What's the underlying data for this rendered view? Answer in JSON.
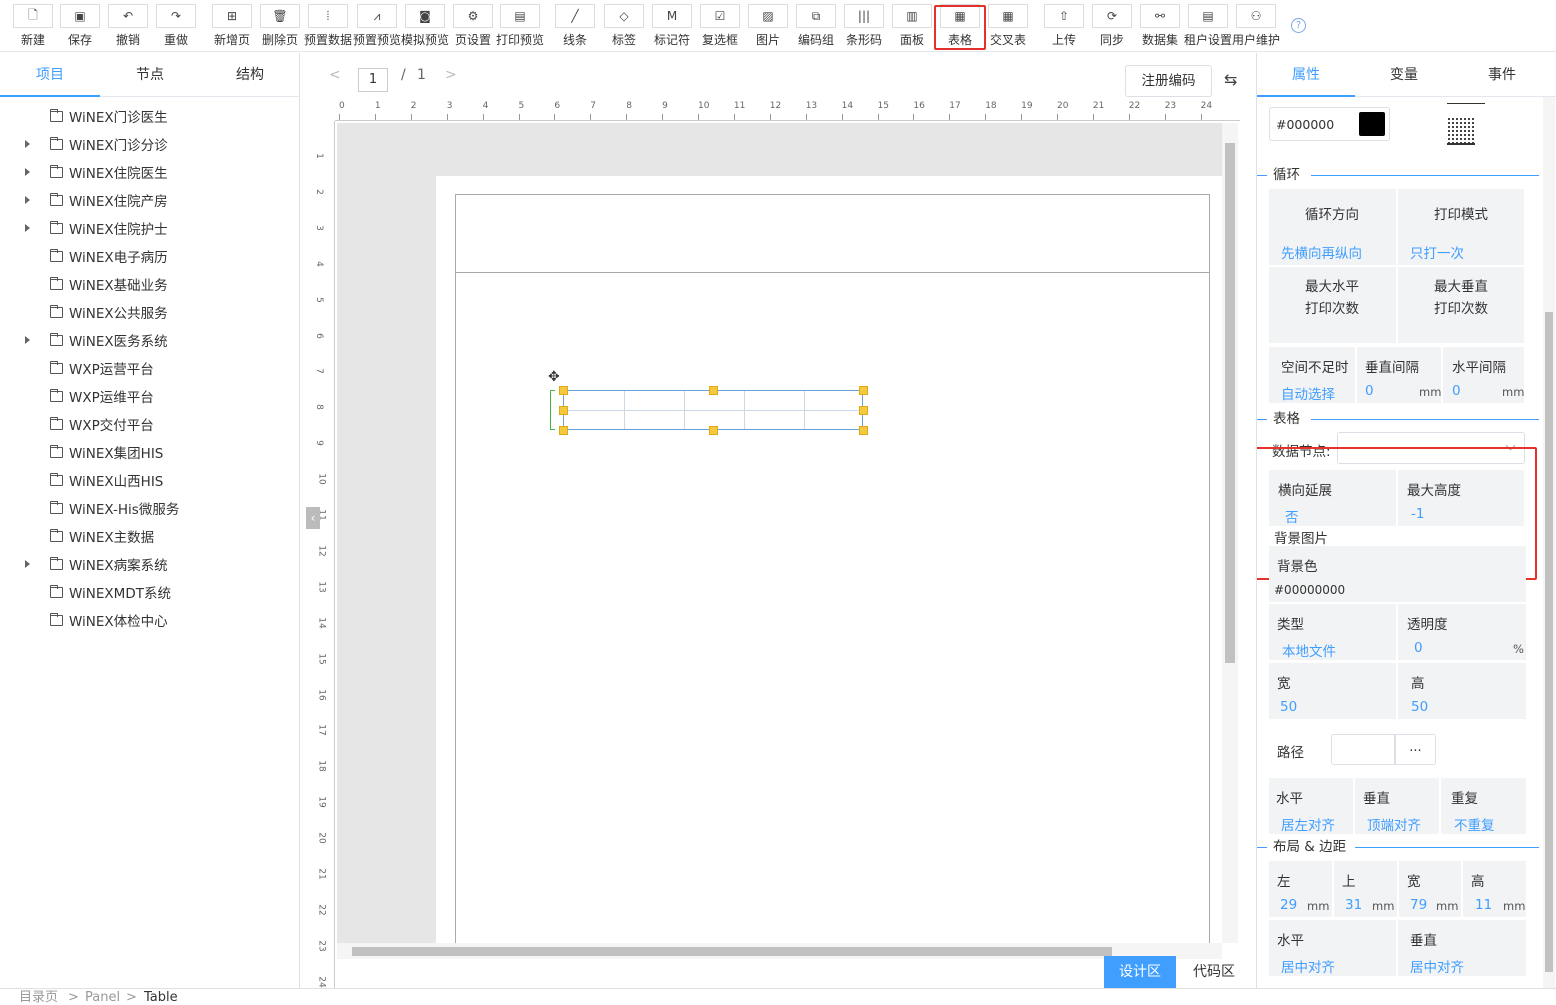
{
  "toolbar": {
    "buttons": [
      {
        "label": "新建",
        "icon": "file-plus-icon"
      },
      {
        "label": "保存",
        "icon": "save-icon"
      },
      {
        "label": "撤销",
        "icon": "undo-icon"
      },
      {
        "label": "重做",
        "icon": "redo-icon"
      },
      {
        "label": "新增页",
        "icon": "add-page-icon"
      },
      {
        "label": "删除页",
        "icon": "trash-icon"
      },
      {
        "label": "预置数据",
        "icon": "preset-data-icon"
      },
      {
        "label": "预置预览",
        "icon": "preview-chart-icon"
      },
      {
        "label": "模拟预览",
        "icon": "camera-icon"
      },
      {
        "label": "页设置",
        "icon": "gear-icon"
      },
      {
        "label": "打印预览",
        "icon": "print-preview-icon"
      },
      {
        "label": "线条",
        "icon": "line-icon"
      },
      {
        "label": "标签",
        "icon": "tag-icon"
      },
      {
        "label": "标记符",
        "icon": "marker-icon"
      },
      {
        "label": "复选框",
        "icon": "checkbox-icon"
      },
      {
        "label": "图片",
        "icon": "image-icon"
      },
      {
        "label": "编码组",
        "icon": "code-group-icon"
      },
      {
        "label": "条形码",
        "icon": "barcode-icon"
      },
      {
        "label": "面板",
        "icon": "panel-icon"
      },
      {
        "label": "表格",
        "icon": "table-icon"
      },
      {
        "label": "交叉表",
        "icon": "crosstab-icon"
      },
      {
        "label": "上传",
        "icon": "upload-icon"
      },
      {
        "label": "同步",
        "icon": "sync-icon"
      },
      {
        "label": "数据集",
        "icon": "dataset-icon"
      },
      {
        "label": "租户设置",
        "icon": "tenant-settings-icon"
      },
      {
        "label": "用户维护",
        "icon": "user-icon"
      }
    ],
    "help": "?"
  },
  "left_panel": {
    "tabs": [
      "项目",
      "节点",
      "结构"
    ],
    "tree": [
      {
        "label": "WiNEX门诊医生",
        "expandable": false
      },
      {
        "label": "WiNEX门诊分诊",
        "expandable": true
      },
      {
        "label": "WiNEX住院医生",
        "expandable": true
      },
      {
        "label": "WiNEX住院产房",
        "expandable": true
      },
      {
        "label": "WiNEX住院护士",
        "expandable": true
      },
      {
        "label": "WiNEX电子病历",
        "expandable": false
      },
      {
        "label": "WiNEX基础业务",
        "expandable": false
      },
      {
        "label": "WiNEX公共服务",
        "expandable": false
      },
      {
        "label": "WiNEX医务系统",
        "expandable": true
      },
      {
        "label": "WXP运营平台",
        "expandable": false
      },
      {
        "label": "WXP运维平台",
        "expandable": false
      },
      {
        "label": "WXP交付平台",
        "expandable": false
      },
      {
        "label": "WiNEX集团HIS",
        "expandable": false
      },
      {
        "label": "WiNEX山西HIS",
        "expandable": false
      },
      {
        "label": "WiNEX-His微服务",
        "expandable": false
      },
      {
        "label": "WiNEX主数据",
        "expandable": false
      },
      {
        "label": "WiNEX病案系统",
        "expandable": true
      },
      {
        "label": "WiNEXMDT系统",
        "expandable": false
      },
      {
        "label": "WiNEX体检中心",
        "expandable": false
      }
    ]
  },
  "center": {
    "pager": {
      "prev": "<",
      "current": "1",
      "sep": "/",
      "total": "1",
      "next": ">"
    },
    "register_button": "注册编码",
    "swap_icon": "⇆",
    "ruler_h": [
      "0",
      "1",
      "2",
      "3",
      "4",
      "5",
      "6",
      "7",
      "8",
      "9",
      "10",
      "11",
      "12",
      "13",
      "14",
      "15",
      "16",
      "17",
      "18",
      "19",
      "20",
      "21",
      "22",
      "23",
      "24"
    ],
    "ruler_v": [
      "1",
      "2",
      "3",
      "4",
      "5",
      "6",
      "7",
      "8",
      "9",
      "10",
      "11",
      "12",
      "13",
      "14",
      "15",
      "16",
      "17",
      "18",
      "19",
      "20",
      "21",
      "22",
      "23",
      "24"
    ],
    "design_button": "设计区",
    "code_button": "代码区"
  },
  "right_panel": {
    "tabs": [
      "属性",
      "变量",
      "事件"
    ],
    "color_value": "#000000",
    "loop": {
      "title": "循环",
      "direction_label": "循环方向",
      "direction_value": "先横向再纵向",
      "print_mode_label": "打印模式",
      "print_mode_value": "只打一次",
      "max_h_label_1": "最大水平",
      "max_h_label_2": "打印次数",
      "max_v_label_1": "最大垂直",
      "max_v_label_2": "打印次数",
      "space_label": "空间不足时",
      "space_value": "自动选择",
      "v_gap_label": "垂直间隔",
      "v_gap_value": "0",
      "h_gap_label": "水平间隔",
      "h_gap_value": "0",
      "unit": "mm"
    },
    "table": {
      "title": "表格",
      "data_node_label": "数据节点:",
      "data_node_value": "",
      "h_extend_label": "横向延展",
      "h_extend_value": "否",
      "max_height_label": "最大高度",
      "max_height_value": "-1"
    },
    "background": {
      "title": "背景图片",
      "color_label": "背景色",
      "color_value": "#00000000",
      "type_label": "类型",
      "type_value": "本地文件",
      "opacity_label": "透明度",
      "opacity_value": "0",
      "opacity_unit": "%",
      "width_label": "宽",
      "width_value": "50",
      "height_label": "高",
      "height_value": "50",
      "path_label": "路径",
      "path_button": "...",
      "h_label": "水平",
      "h_value": "居左对齐",
      "v_label": "垂直",
      "v_value": "顶端对齐",
      "repeat_label": "重复",
      "repeat_value": "不重复"
    },
    "layout": {
      "title": "布局 & 边距",
      "left_label": "左",
      "left_value": "29",
      "top_label": "上",
      "top_value": "31",
      "width_label": "宽",
      "width_value": "79",
      "height_label": "高",
      "height_value": "11",
      "unit": "mm",
      "h_label": "水平",
      "h_value": "居中对齐",
      "v_label": "垂直",
      "v_value": "居中对齐"
    }
  },
  "status": {
    "crumbs": [
      "目录页",
      ">",
      "Panel",
      ">",
      "Table"
    ]
  },
  "colors": {
    "accent": "#409eff",
    "highlight": "#e5302b",
    "handle": "#f4c93b"
  }
}
